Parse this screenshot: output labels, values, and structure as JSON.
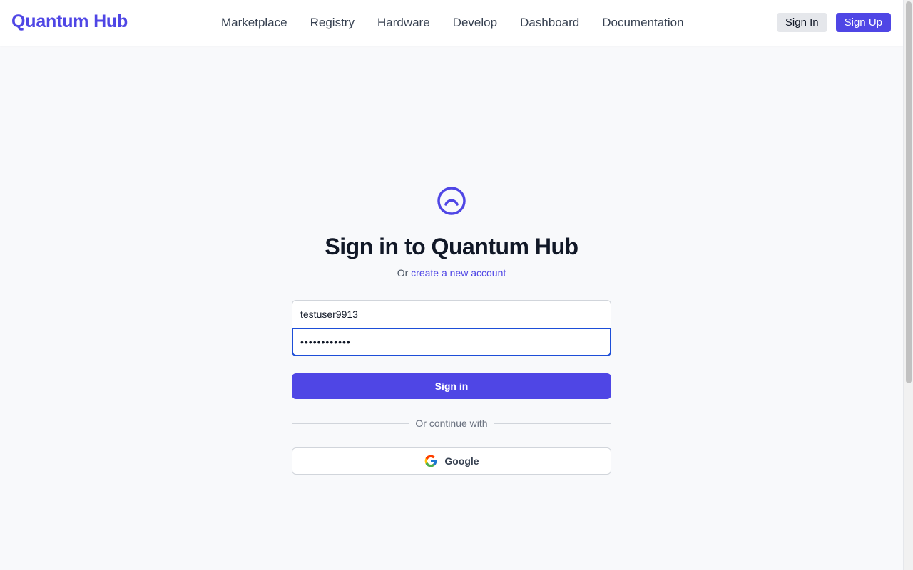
{
  "header": {
    "brand": "Quantum Hub",
    "nav": [
      "Marketplace",
      "Registry",
      "Hardware",
      "Develop",
      "Dashboard",
      "Documentation"
    ],
    "sign_in": "Sign In",
    "sign_up": "Sign Up"
  },
  "login": {
    "title": "Sign in to Quantum Hub",
    "subtitle_prefix": "Or",
    "subtitle_link": "create a new account",
    "username_value": "testuser9913",
    "password_value": "••••••••••••",
    "submit_label": "Sign in",
    "divider_label": "Or continue with",
    "google_label": "Google"
  },
  "colors": {
    "accent": "#4f46e5",
    "focus_border": "#1d4ed8",
    "background": "#f8f9fb"
  },
  "icons": {
    "logo": "quantum-arc-icon",
    "google": "google-g-icon"
  }
}
